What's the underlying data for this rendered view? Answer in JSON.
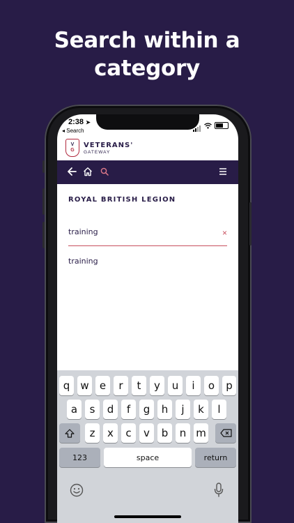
{
  "headline": {
    "line1": "Search within a",
    "line2": "category"
  },
  "status_bar": {
    "time": "2:38",
    "back_label": "◂ Search"
  },
  "brand": {
    "logo_v": "V",
    "logo_g": "G",
    "name": "VETERANS'",
    "subtitle": "GATEWAY",
    "accent_color": "#b0273c"
  },
  "nav": {
    "back_icon": "arrow-left-icon",
    "home_icon": "home-icon",
    "search_icon": "search-icon",
    "menu_icon": "hamburger-menu-icon",
    "bar_color": "#281c47"
  },
  "main": {
    "category_title": "ROYAL BRITISH LEGION",
    "search": {
      "value": "training",
      "clear_label": "×"
    },
    "results": [
      "training"
    ]
  },
  "keyboard": {
    "row1": [
      "q",
      "w",
      "e",
      "r",
      "t",
      "y",
      "u",
      "i",
      "o",
      "p"
    ],
    "row2": [
      "a",
      "s",
      "d",
      "f",
      "g",
      "h",
      "j",
      "k",
      "l"
    ],
    "row3": [
      "z",
      "x",
      "c",
      "v",
      "b",
      "n",
      "m"
    ],
    "numbers_label": "123",
    "space_label": "space",
    "return_label": "return"
  }
}
